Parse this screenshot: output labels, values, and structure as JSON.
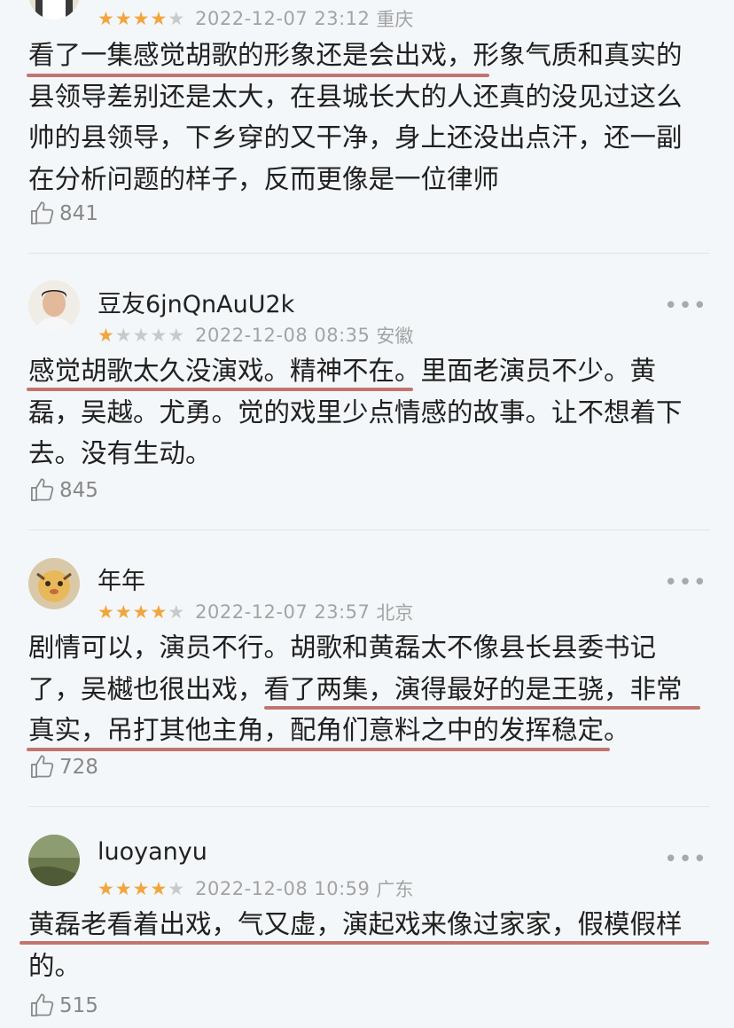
{
  "comments": [
    {
      "username": "",
      "rating": 4,
      "date": "2022-12-07 23:12",
      "location": "重庆",
      "lines": [
        "看了一集感觉胡歌的形象还是会出戏，形象气质和真实的",
        "县领导差别还是太大，在县城长大的人还真的没见过这么",
        "帅的县领导，下乡穿的又干净，身上还没出点汗，还一副",
        "在分析问题的样子，反而更像是一位律师"
      ],
      "likes": "841"
    },
    {
      "username": "豆友6jnQnAuU2k",
      "rating": 1,
      "date": "2022-12-08 08:35",
      "location": "安徽",
      "lines": [
        "感觉胡歌太久没演戏。精神不在。里面老演员不少。黄",
        "磊，吴越。尤勇。觉的戏里少点情感的故事。让不想着下",
        "去。没有生动。"
      ],
      "likes": "845"
    },
    {
      "username": "年年",
      "rating": 4,
      "date": "2022-12-07 23:57",
      "location": "北京",
      "lines": [
        "剧情可以，演员不行。胡歌和黄磊太不像县长县委书记",
        "了，吴樾也很出戏，看了两集，演得最好的是王骁，非常",
        "真实，吊打其他主角，配角们意料之中的发挥稳定。"
      ],
      "likes": "728"
    },
    {
      "username": "luoyanyu",
      "rating": 4,
      "date": "2022-12-08 10:59",
      "location": "广东",
      "lines": [
        "黄磊老看着出戏，气又虚，演起戏来像过家家，假模假样",
        "的。"
      ],
      "likes": "515"
    }
  ],
  "more_symbol": "•••",
  "colors": {
    "star": "#f2a53c",
    "underline": "#c2756f",
    "text": "#202020",
    "meta": "#a3a3a3"
  },
  "icons": {
    "like": "thumbs-up-icon",
    "more": "more-options-icon"
  }
}
